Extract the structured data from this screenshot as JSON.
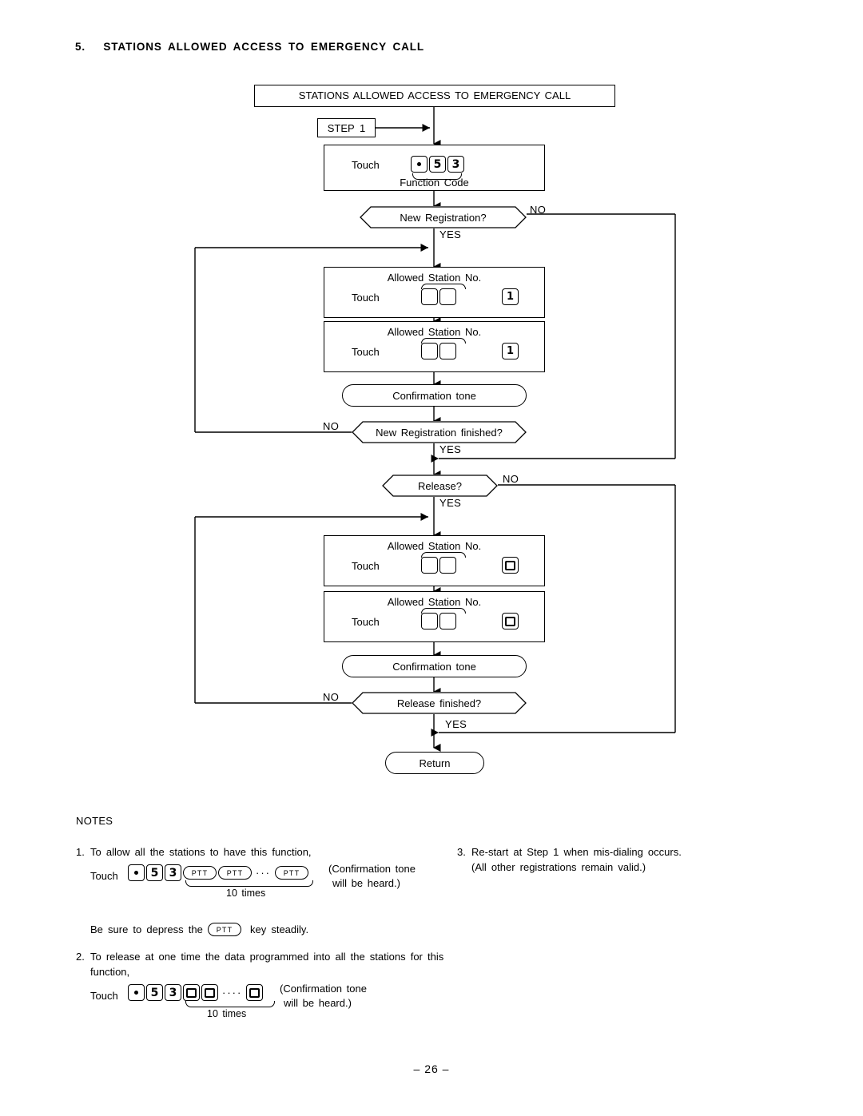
{
  "document": {
    "section_number": "5.",
    "section_title": "STATIONS ALLOWED ACCESS TO EMERGENCY CALL",
    "page_number": "– 26 –"
  },
  "flowchart": {
    "header_box": "STATIONS  ALLOWED  ACCESS  TO  EMERGENCY  CALL",
    "step_box": "STEP  1",
    "touch_label": "Touch",
    "function_code_label": "Function  Code",
    "function_code_keys": [
      "dot",
      "5",
      "3"
    ],
    "decisions": {
      "new_registration": "New  Registration?",
      "new_registration_finished": "New  Registration  finished?",
      "release": "Release?",
      "release_finished": "Release  finished?"
    },
    "branch_labels": {
      "yes": "YES",
      "no": "NO"
    },
    "station_box_label": "Allowed  Station  No.",
    "registration_key": "1",
    "release_key": "0",
    "confirmation_tone": "Confirmation  tone",
    "return_terminal": "Return"
  },
  "notes": {
    "heading": "NOTES",
    "items": [
      {
        "number": "1.",
        "text": "To  allow  all  the  stations  to  have  this  function,",
        "touch_label": "Touch",
        "keys_prefix": [
          "dot",
          "5",
          "3"
        ],
        "repeat_key": "PTT",
        "repeat_count_label": "10  times",
        "dots": "···",
        "result_line1": "(Confirmation  tone",
        "result_line2": "will  be  heard.)",
        "sub_text_before": "Be  sure  to  depress  the",
        "sub_key": "PTT",
        "sub_text_after": "key  steadily."
      },
      {
        "number": "2.",
        "text": "To  release  at  one  time  the  data  programmed  into  all  the  stations  for  this",
        "text_line2": "function,",
        "touch_label": "Touch",
        "keys_prefix": [
          "dot",
          "5",
          "3"
        ],
        "repeat_key": "0",
        "repeat_count_label": "10  times",
        "dots": "····",
        "result_line1": "(Confirmation  tone",
        "result_line2": "will  be  heard.)"
      },
      {
        "number": "3.",
        "text": "Re-start  at  Step  1  when  mis-dialing  occurs.",
        "text_line2": "(All  other  registrations  remain  valid.)"
      }
    ]
  }
}
